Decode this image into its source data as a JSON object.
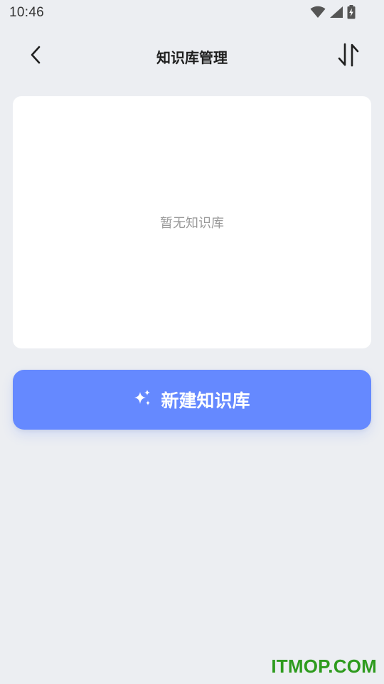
{
  "status_bar": {
    "time": "10:46",
    "icons": [
      "wifi-icon",
      "signal-icon",
      "battery-charging-icon"
    ]
  },
  "header": {
    "title": "知识库管理",
    "back_icon": "chevron-left-icon",
    "sort_icon": "sort-arrows-icon"
  },
  "knowledge_list": {
    "items": [],
    "empty_text": "暂无知识库"
  },
  "create_button": {
    "label": "新建知识库",
    "icon": "sparkle-icon",
    "color": "#6589FF"
  },
  "watermark": {
    "text": "ITMOP.COM",
    "color": "#2E9B1E"
  },
  "colors": {
    "background": "#ECEEF2",
    "card": "#FFFFFF",
    "empty_text": "#999999",
    "title": "#1F1F1F"
  }
}
